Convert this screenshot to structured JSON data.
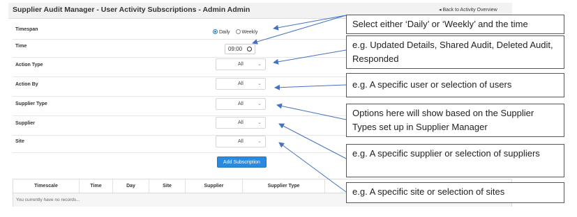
{
  "header": {
    "title": "Supplier Audit Manager - User Activity Subscriptions - Admin Admin",
    "back_link": "Back to Activity Overview"
  },
  "form": {
    "timespan": {
      "label": "Timespan",
      "options": [
        "Daily",
        "Weekly"
      ],
      "selected": "Daily"
    },
    "time": {
      "label": "Time",
      "value": "09:00"
    },
    "action_type": {
      "label": "Action Type",
      "value": "All"
    },
    "action_by": {
      "label": "Action By",
      "value": "All"
    },
    "supplier_type": {
      "label": "Supplier Type",
      "value": "All"
    },
    "supplier": {
      "label": "Supplier",
      "value": "All"
    },
    "site": {
      "label": "Site",
      "value": "All"
    },
    "add_button": "Add Subscription"
  },
  "table": {
    "columns": [
      "Timescale",
      "Time",
      "Day",
      "Site",
      "Supplier",
      "Supplier Type"
    ],
    "empty_text": "You currently have no records..."
  },
  "callouts": [
    "Select either ‘Daily’ or ‘Weekly’ and the time",
    "e.g. Updated Details, Shared Audit, Deleted Audit, Responded",
    "e.g. A specific user or selection of users",
    "Options here will show based on the Supplier Types set up in Supplier Manager",
    "e.g. A specific supplier or selection of suppliers",
    "e.g. A specific site or selection of sites"
  ],
  "colors": {
    "accent": "#2a8ae0",
    "arrow": "#4472c4"
  }
}
